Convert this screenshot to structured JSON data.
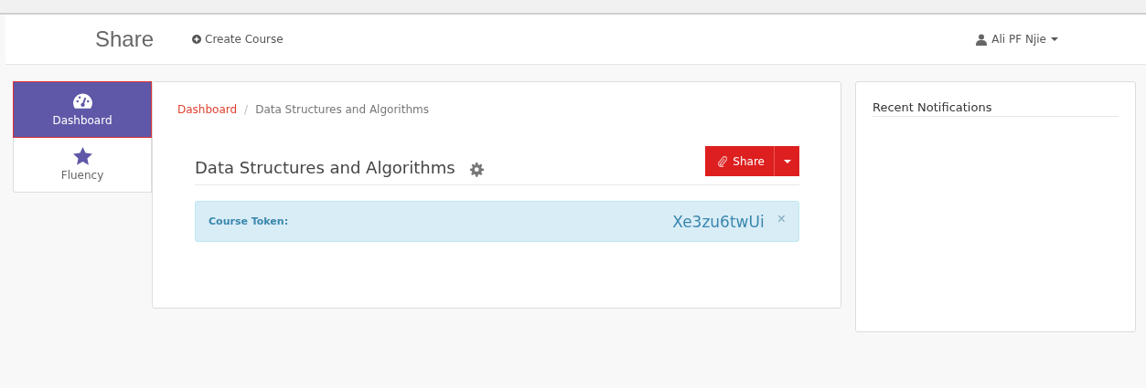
{
  "navbar": {
    "brand": "Share",
    "create_course": "Create Course",
    "user": "Ali PF Njie"
  },
  "sidebar": {
    "items": [
      {
        "label": "Dashboard",
        "kind": "gauge",
        "selected": true
      },
      {
        "label": "Fluency",
        "kind": "star",
        "selected": false
      }
    ]
  },
  "breadcrumb": {
    "separator": "/",
    "items": [
      "Dashboard",
      "Data Structures and Algorithms"
    ]
  },
  "course": {
    "title": "Data Structures and Algorithms",
    "share_button": "Share",
    "token_label": "Course Token:",
    "token": "Xe3zu6twUi",
    "close": "×"
  },
  "notifications": {
    "title": "Recent Notifications"
  }
}
